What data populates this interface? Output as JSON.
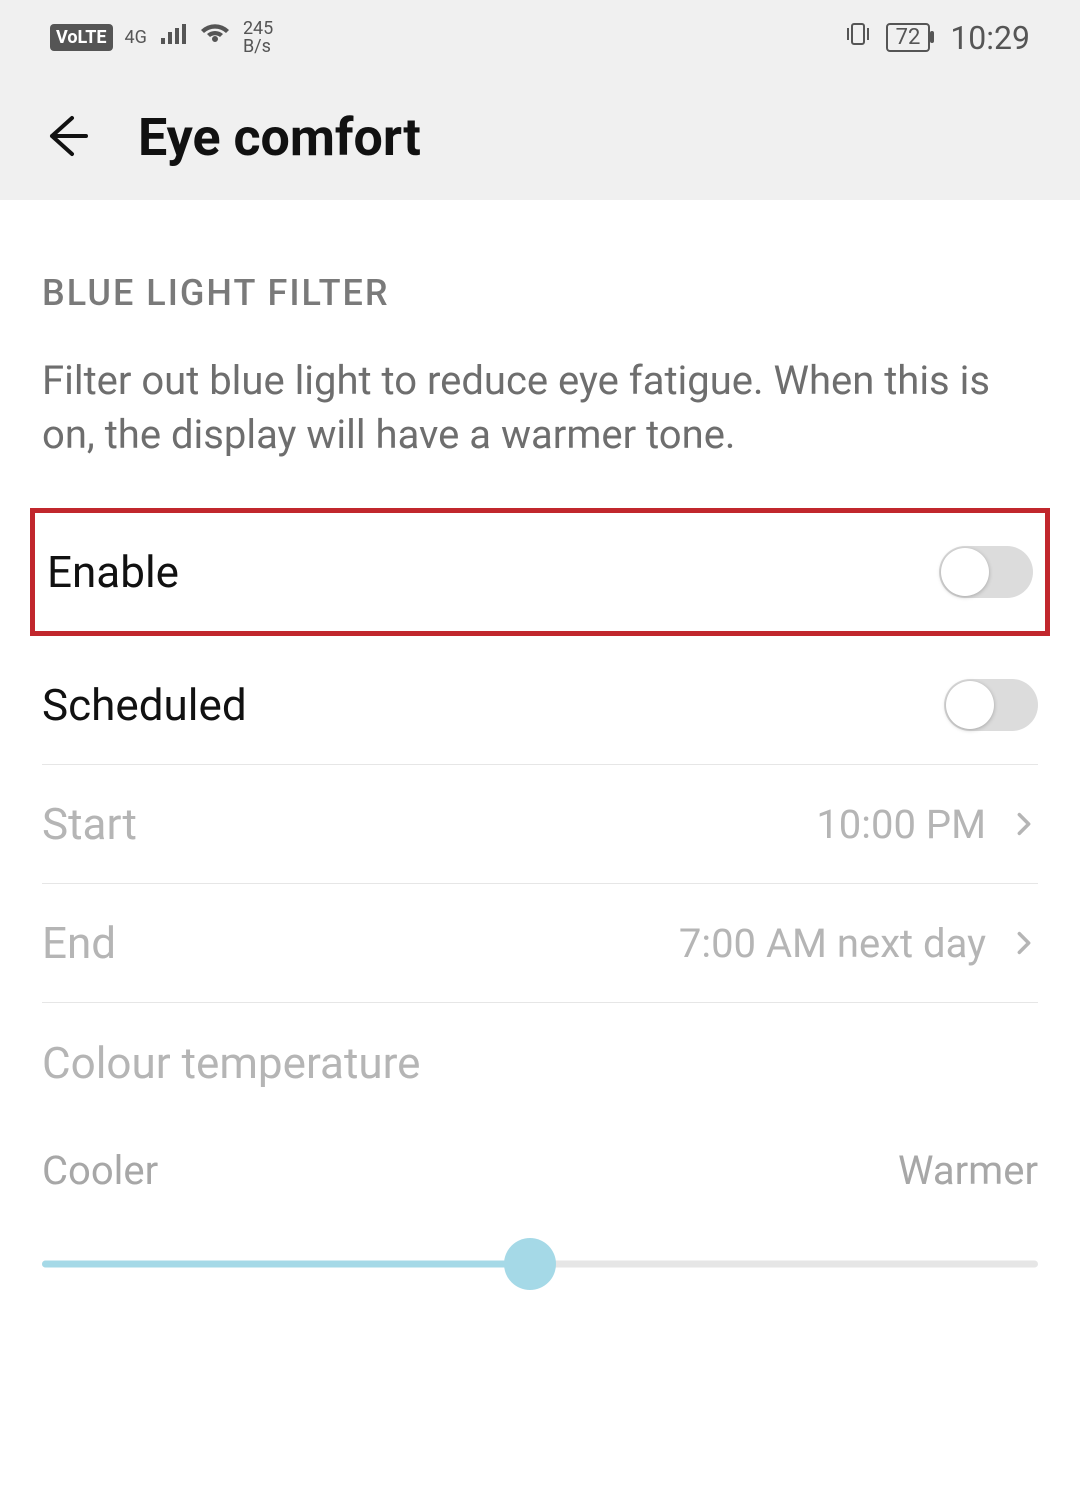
{
  "statusBar": {
    "volte": "VoLTE",
    "networkTop": "4G",
    "speedTop": "245",
    "speedBottom": "B/s",
    "battery": "72",
    "time": "10:29"
  },
  "header": {
    "title": "Eye comfort"
  },
  "section": {
    "heading": "BLUE LIGHT FILTER",
    "description": "Filter out blue light to reduce eye fatigue. When this is on, the display will have a warmer tone."
  },
  "rows": {
    "enable": {
      "label": "Enable",
      "on": false
    },
    "scheduled": {
      "label": "Scheduled",
      "on": false
    },
    "start": {
      "label": "Start",
      "value": "10:00 PM"
    },
    "end": {
      "label": "End",
      "value": "7:00 AM next day"
    }
  },
  "temperature": {
    "label": "Colour temperature",
    "cooler": "Cooler",
    "warmer": "Warmer",
    "percent": 49
  }
}
